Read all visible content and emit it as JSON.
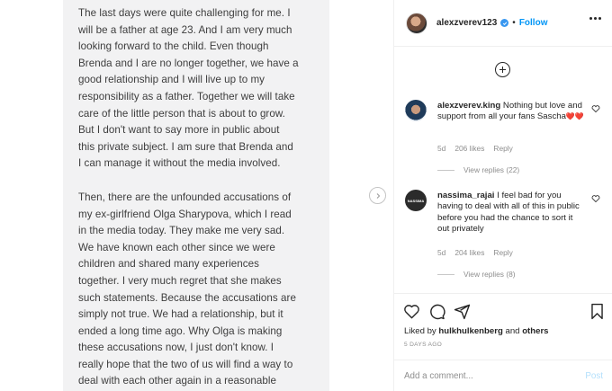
{
  "note": {
    "paragraph1": "The last days were quite challenging for me. I\nwill be a father at age 23. And I am very much\nlooking forward to the child. Even though\nBrenda and I are no longer together, we have a\ngood relationship and I will live up to my\nresponsibility as a father. Together we will take\ncare of the little person that is about to grow.\nBut I don't want to say more in public about\nthis private subject. I am sure that Brenda and\nI can manage it without the media involved.",
    "paragraph2": "Then, there are the unfounded accusations of\nmy ex-girlfriend Olga Sharypova, which I read\nin the media today. They make me very sad.\nWe have known each other since we were\nchildren and shared many experiences\ntogether. I very much regret that she makes\nsuch statements. Because the accusations are\nsimply not true. We had a relationship, but it\nended a long time ago. Why Olga is making\nthese accusations now, I just don't know. I\nreally hope that the two of us will find a way to\ndeal with each other again in a reasonable\nand respectful way."
  },
  "header": {
    "username": "alexzverev123",
    "separator": "•",
    "follow_label": "Follow"
  },
  "comments": [
    {
      "username": "alexzverev.king",
      "text": " Nothing but love and support from all your fans Sascha",
      "hearts": "❤️❤️",
      "age": "5d",
      "likes": "206 likes",
      "reply_label": "Reply",
      "view_replies": "View replies (22)"
    },
    {
      "username": "nassima_rajai",
      "avatar_text": "NASSIMA",
      "text": " I feel bad for you having to deal with all of this in public before you had the chance to sort it out privately",
      "age": "5d",
      "likes": "204 likes",
      "reply_label": "Reply",
      "view_replies": "View replies (8)"
    }
  ],
  "footer": {
    "liked_prefix": "Liked by ",
    "liked_user": "hulkhulkenberg",
    "liked_and": " and ",
    "liked_others": "others",
    "date": "5 DAYS AGO",
    "comment_placeholder": "Add a comment...",
    "post_label": "Post"
  },
  "icons": {
    "add": "add-circle-icon",
    "heart": "heart-icon",
    "comment": "comment-icon",
    "share": "share-icon",
    "save": "bookmark-icon",
    "more": "more-options-icon",
    "next": "chevron-right-icon"
  },
  "colors": {
    "link_blue": "#0095f6",
    "verified_blue": "#3897f0",
    "note_background": "#f2f2f3"
  }
}
